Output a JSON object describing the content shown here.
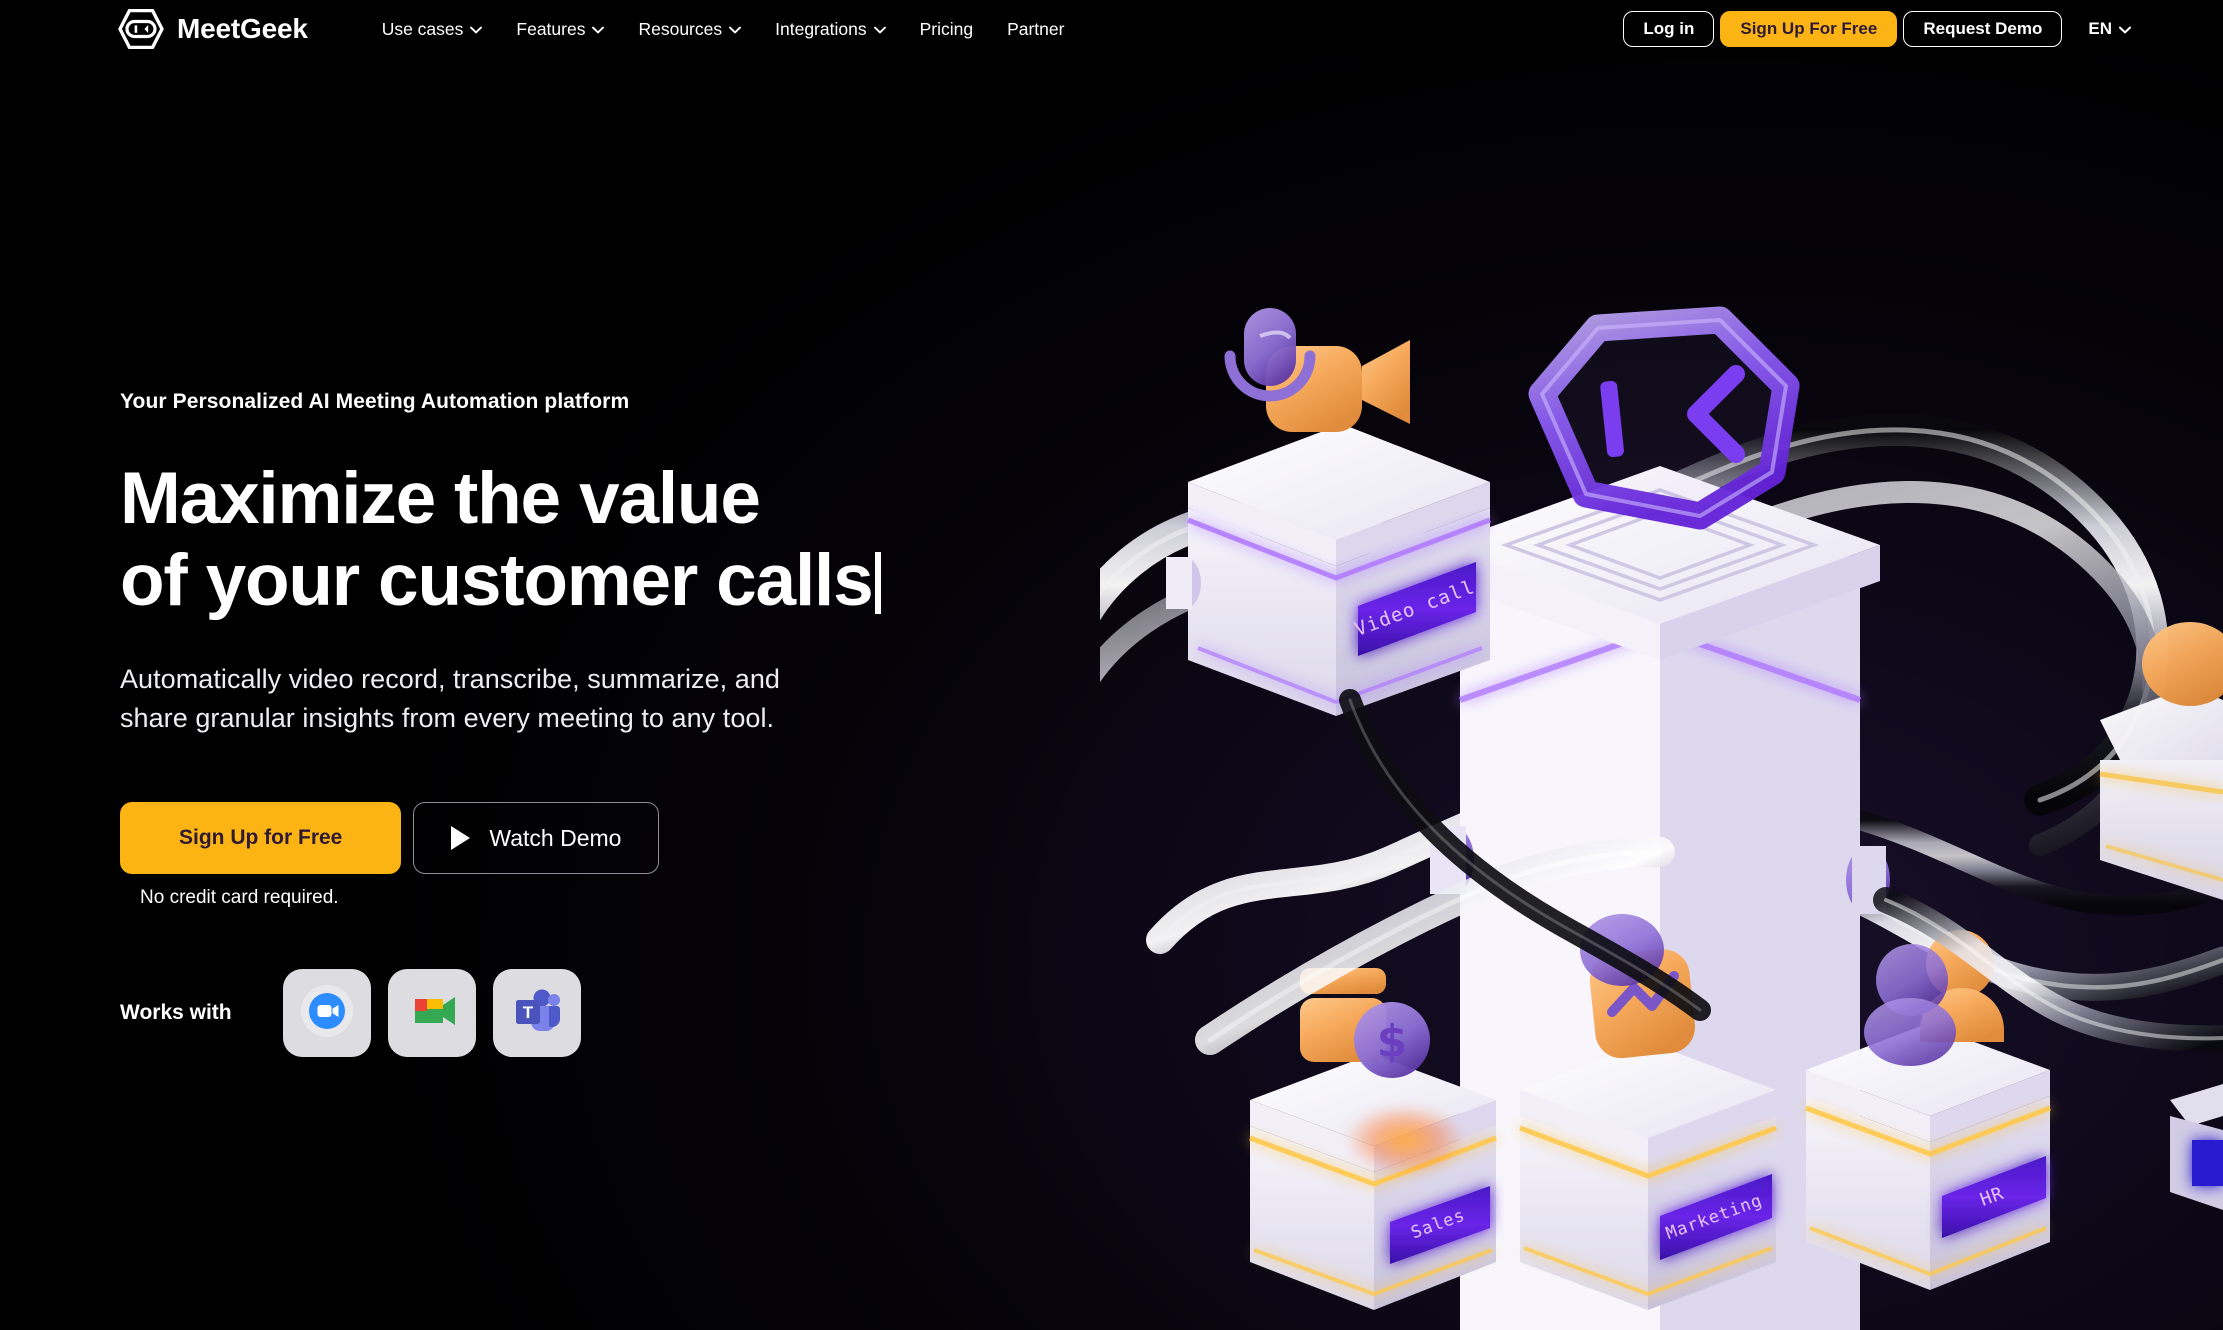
{
  "brand": {
    "name": "MeetGeek",
    "logo_icon": "meetgeek-hexagon-logo"
  },
  "nav": {
    "links": [
      {
        "label": "Use cases",
        "has_dropdown": true
      },
      {
        "label": "Features",
        "has_dropdown": true
      },
      {
        "label": "Resources",
        "has_dropdown": true
      },
      {
        "label": "Integrations",
        "has_dropdown": true
      },
      {
        "label": "Pricing",
        "has_dropdown": false
      },
      {
        "label": "Partner",
        "has_dropdown": false
      }
    ],
    "login_label": "Log in",
    "signup_label": "Sign Up For Free",
    "demo_label": "Request Demo",
    "language": "EN"
  },
  "hero": {
    "eyebrow": "Your Personalized AI Meeting Automation platform",
    "headline_line1": "Maximize the value",
    "headline_line2": "of your customer calls",
    "subhead_line1": "Automatically video record, transcribe, summarize, and",
    "subhead_line2": "share granular insights from every meeting to any tool.",
    "cta_primary": "Sign Up for Free",
    "cta_secondary": "Watch Demo",
    "note": "No credit card required.",
    "works_with_label": "Works with",
    "integrations": [
      {
        "name": "Zoom",
        "icon": "zoom-icon"
      },
      {
        "name": "Google Meet",
        "icon": "google-meet-icon"
      },
      {
        "name": "Microsoft Teams",
        "icon": "microsoft-teams-icon"
      }
    ]
  },
  "illustration": {
    "alt": "3D render of connected white modules linked by glossy tubes",
    "labels": [
      {
        "text": "Video call",
        "color": "#c98bff"
      },
      {
        "text": "Sales",
        "color": "#d79bff"
      },
      {
        "text": "Marketing",
        "color": "#e3b0ff"
      },
      {
        "text": "HR",
        "color": "#d79bff"
      }
    ],
    "badges": [
      {
        "name": "microphone-camera-badge"
      },
      {
        "name": "meetgeek-hex-badge"
      },
      {
        "name": "money-bag-badge"
      },
      {
        "name": "analytics-chart-badge"
      },
      {
        "name": "people-badge"
      }
    ]
  },
  "colors": {
    "background": "#000000",
    "accent_yellow": "#FCB415",
    "accent_yellow_text": "#2e1a33",
    "text_primary": "#ffffff",
    "tile_gray": "#dddde1",
    "neon_purple": "#7a3df0",
    "module_white": "#f2f0f7"
  }
}
